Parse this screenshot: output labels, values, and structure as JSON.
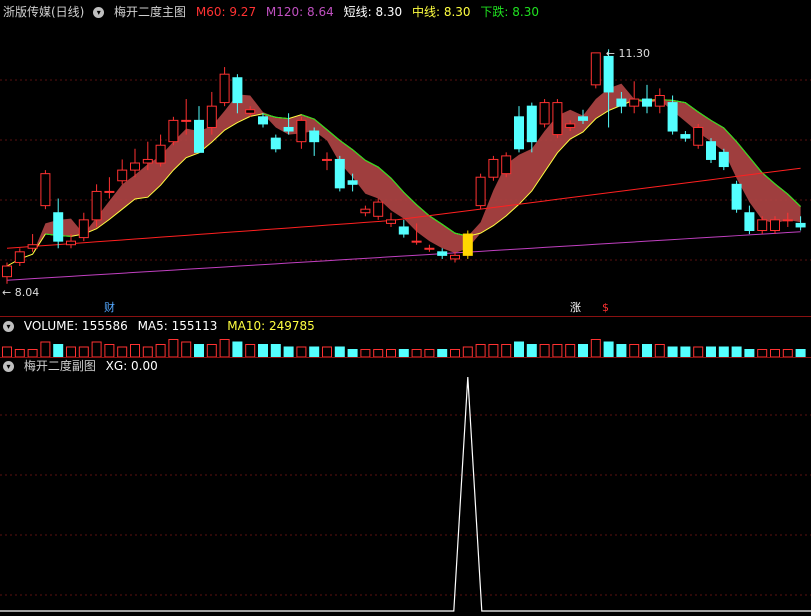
{
  "main": {
    "stock": "浙版传媒(日线)",
    "indicator": "梅开二度主图",
    "m60": {
      "label": "M60: ",
      "value": "9.27"
    },
    "m120": {
      "label": "M120: ",
      "value": "8.64"
    },
    "short": {
      "label": "短线: ",
      "value": "8.30"
    },
    "mid": {
      "label": "中线: ",
      "value": "8.30"
    },
    "down": {
      "label": "下跌: ",
      "value": "8.30"
    },
    "high_label": "11.30",
    "low_label": "8.04",
    "marker_cai": "财",
    "marker_zhang": "涨",
    "marker_s": "$"
  },
  "volume": {
    "title": "VOLUME: 155586",
    "ma5": "MA5: 155113",
    "ma10": "MA10: 249785"
  },
  "sub": {
    "indicator": "梅开二度副图",
    "xg": "XG: 0.00"
  },
  "colors": {
    "up": "#ff3232",
    "down": "#54ffff",
    "m60": "#ff2020",
    "m120": "#c040c0",
    "short": "#ffff40",
    "mid": "#ffff40",
    "green": "#20e020",
    "fill": "#b04545",
    "signal": "#ffd700"
  },
  "chart_data": [
    {
      "type": "candlestick",
      "price_range": [
        7.8,
        11.6
      ],
      "candles": [
        [
          8.1,
          8.3,
          8.0,
          8.25
        ],
        [
          8.3,
          8.5,
          8.25,
          8.45
        ],
        [
          8.5,
          8.7,
          8.45,
          8.55
        ],
        [
          9.1,
          9.6,
          9.05,
          9.55
        ],
        [
          9.0,
          9.2,
          8.5,
          8.6
        ],
        [
          8.55,
          8.7,
          8.5,
          8.6
        ],
        [
          8.65,
          9.0,
          8.6,
          8.9
        ],
        [
          8.9,
          9.4,
          8.8,
          9.3
        ],
        [
          9.3,
          9.5,
          9.2,
          9.3
        ],
        [
          9.45,
          9.75,
          9.4,
          9.6
        ],
        [
          9.6,
          9.9,
          9.5,
          9.7
        ],
        [
          9.7,
          10.0,
          9.6,
          9.75
        ],
        [
          9.7,
          10.1,
          9.65,
          9.95
        ],
        [
          10.0,
          10.35,
          9.95,
          10.3
        ],
        [
          10.3,
          10.6,
          10.1,
          10.3
        ],
        [
          10.3,
          10.5,
          9.85,
          9.85
        ],
        [
          10.2,
          10.7,
          10.1,
          10.5
        ],
        [
          10.55,
          11.05,
          10.5,
          10.95
        ],
        [
          10.9,
          10.95,
          10.4,
          10.55
        ],
        [
          10.4,
          10.5,
          10.35,
          10.45
        ],
        [
          10.35,
          10.4,
          10.2,
          10.25
        ],
        [
          10.05,
          10.1,
          9.85,
          9.9
        ],
        [
          10.2,
          10.4,
          10.1,
          10.15
        ],
        [
          10.0,
          10.35,
          9.9,
          10.3
        ],
        [
          10.15,
          10.2,
          9.8,
          10.0
        ],
        [
          9.75,
          9.85,
          9.6,
          9.75
        ],
        [
          9.75,
          9.8,
          9.3,
          9.35
        ],
        [
          9.45,
          9.55,
          9.3,
          9.4
        ],
        [
          9.0,
          9.1,
          8.95,
          9.05
        ],
        [
          8.95,
          9.2,
          8.9,
          9.15
        ],
        [
          8.85,
          9.0,
          8.8,
          8.9
        ],
        [
          8.8,
          8.9,
          8.65,
          8.7
        ],
        [
          8.6,
          8.85,
          8.55,
          8.6
        ],
        [
          8.5,
          8.55,
          8.45,
          8.5
        ],
        [
          8.45,
          8.5,
          8.35,
          8.4
        ],
        [
          8.35,
          8.45,
          8.3,
          8.4
        ],
        [
          8.4,
          8.75,
          8.35,
          8.7
        ],
        [
          9.1,
          9.55,
          9.05,
          9.5
        ],
        [
          9.5,
          9.8,
          9.45,
          9.75
        ],
        [
          9.55,
          9.85,
          9.5,
          9.8
        ],
        [
          10.35,
          10.5,
          9.85,
          9.9
        ],
        [
          10.5,
          10.55,
          9.85,
          10.0
        ],
        [
          10.25,
          10.6,
          10.2,
          10.55
        ],
        [
          10.1,
          10.6,
          10.05,
          10.55
        ],
        [
          10.2,
          10.3,
          10.15,
          10.25
        ],
        [
          10.35,
          10.45,
          10.25,
          10.3
        ],
        [
          10.8,
          11.25,
          10.75,
          11.25
        ],
        [
          11.2,
          11.3,
          10.2,
          10.7
        ],
        [
          10.6,
          10.7,
          10.4,
          10.5
        ],
        [
          10.5,
          10.85,
          10.4,
          10.6
        ],
        [
          10.6,
          10.8,
          10.4,
          10.5
        ],
        [
          10.5,
          10.75,
          10.4,
          10.65
        ],
        [
          10.55,
          10.65,
          10.1,
          10.15
        ],
        [
          10.1,
          10.15,
          10.0,
          10.05
        ],
        [
          9.95,
          10.25,
          9.9,
          10.2
        ],
        [
          10.0,
          10.05,
          9.7,
          9.75
        ],
        [
          9.85,
          9.9,
          9.6,
          9.65
        ],
        [
          9.4,
          9.45,
          9.0,
          9.05
        ],
        [
          9.0,
          9.1,
          8.7,
          8.75
        ],
        [
          8.75,
          8.95,
          8.7,
          8.9
        ],
        [
          8.75,
          8.95,
          8.7,
          8.9
        ],
        [
          8.9,
          9.0,
          8.8,
          8.9
        ],
        [
          8.85,
          8.95,
          8.75,
          8.8
        ]
      ],
      "signal_bar_index": 36
    },
    {
      "type": "bar",
      "name": "volume",
      "values_relative": [
        4,
        3,
        3,
        6,
        5,
        4,
        4,
        6,
        5,
        4,
        5,
        4,
        5,
        7,
        6,
        5,
        5,
        7,
        6,
        5,
        5,
        5,
        4,
        4,
        4,
        4,
        4,
        3,
        3,
        3,
        3,
        3,
        3,
        3,
        3,
        3,
        4,
        5,
        5,
        5,
        6,
        5,
        5,
        5,
        5,
        5,
        7,
        6,
        5,
        5,
        5,
        5,
        4,
        4,
        4,
        4,
        4,
        4,
        3,
        3,
        3,
        3,
        3
      ]
    },
    {
      "type": "line",
      "name": "XG",
      "values": "0 everywhere except 1 at the signal bar"
    }
  ]
}
